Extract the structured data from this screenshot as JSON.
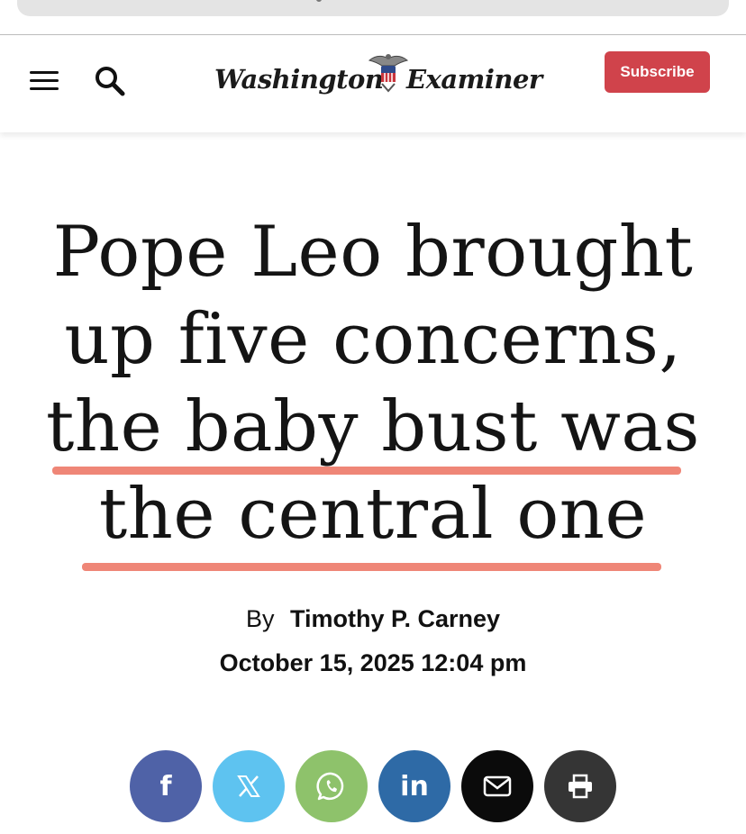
{
  "header": {
    "logo_left": "Washington",
    "logo_right": "Examiner",
    "subscribe_label": "Subscribe",
    "accent_color": "#d0434b"
  },
  "article": {
    "headline_lines": [
      "Pope Leo brought",
      "up five concerns,",
      "the baby bust was",
      "the central one"
    ],
    "highlight_color": "#ee7c6b",
    "byline_prefix": "By",
    "author": "Timothy P. Carney",
    "date": "October 15, 2025 12:04 pm"
  },
  "share": {
    "buttons": [
      {
        "name": "facebook",
        "glyph": "f",
        "color": "#4f62a7"
      },
      {
        "name": "x",
        "glyph": "𝕏",
        "color": "#5ec3f0"
      },
      {
        "name": "whatsapp",
        "icon": "whatsapp-icon",
        "color": "#8ec26b"
      },
      {
        "name": "linkedin",
        "glyph": "in",
        "color": "#2e6aa6"
      },
      {
        "name": "email",
        "icon": "envelope-icon",
        "color": "#0b0b0b"
      },
      {
        "name": "print",
        "icon": "printer-icon",
        "color": "#353535"
      }
    ]
  }
}
